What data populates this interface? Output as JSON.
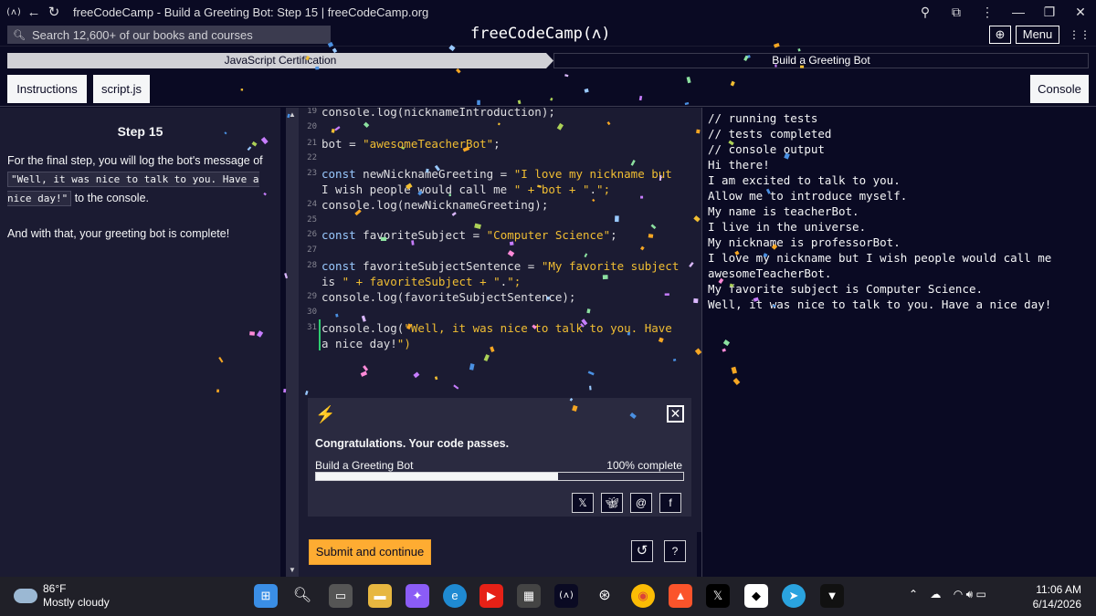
{
  "browser": {
    "title": "freeCodeCamp - Build a Greeting Bot: Step 15 | freeCodeCamp.org",
    "app_icon": "(ʌ)"
  },
  "navbar": {
    "search_placeholder": "Search 12,600+ of our books and courses",
    "logo": "freeCodeCamp(ʌ)",
    "menu_label": "Menu"
  },
  "breadcrumb": {
    "certification": "JavaScript Certification",
    "project": "Build a Greeting Bot"
  },
  "tabs": {
    "instructions": "Instructions",
    "file": "script.js",
    "console": "Console"
  },
  "instructions": {
    "heading": "Step 15",
    "p1_before": "For the final step, you will log the bot's message of ",
    "p1_code": "\"Well, it was nice to talk to you. Have a nice day!\"",
    "p1_after": " to the console.",
    "p2": "And with that, your greeting bot is complete!"
  },
  "editor": {
    "lines": [
      {
        "n": "19",
        "t": "console.log(nicknameIntroduction);"
      },
      {
        "n": "20",
        "t": ""
      },
      {
        "n": "21",
        "t": "bot = \"awesomeTeacherBot\";"
      },
      {
        "n": "22",
        "t": ""
      },
      {
        "n": "23",
        "t": "const newNicknameGreeting = \"I love my nickname but"
      },
      {
        "n": "",
        "t": "I wish people would call me \" + bot + \".\";"
      },
      {
        "n": "24",
        "t": "console.log(newNicknameGreeting);"
      },
      {
        "n": "25",
        "t": ""
      },
      {
        "n": "26",
        "t": "const favoriteSubject = \"Computer Science\";"
      },
      {
        "n": "27",
        "t": ""
      },
      {
        "n": "28",
        "t": "const favoriteSubjectSentence = \"My favorite subject"
      },
      {
        "n": "",
        "t": "is \" + favoriteSubject + \".\";"
      },
      {
        "n": "29",
        "t": "console.log(favoriteSubjectSentence);"
      },
      {
        "n": "30",
        "t": ""
      },
      {
        "n": "31",
        "t": "console.log(\"Well, it was nice to talk to you. Have"
      },
      {
        "n": "",
        "t": "a nice day!\")"
      }
    ]
  },
  "modal": {
    "message": "Congratulations. Your code passes.",
    "project_name": "Build a Greeting Bot",
    "percent_label": "100% complete",
    "progress": 0.66
  },
  "actions": {
    "submit_label": "Submit and continue"
  },
  "console": {
    "lines": [
      "// running tests",
      "// tests completed",
      "// console output",
      "Hi there!",
      "I am excited to talk to you.",
      "Allow me to introduce myself.",
      "My name is teacherBot.",
      "I live in the universe.",
      "My nickname is professorBot.",
      "I love my nickname but I wish people would call me awesomeTeacherBot.",
      "My favorite subject is Computer Science.",
      "Well, it was nice to talk to you. Have a nice day!"
    ]
  },
  "taskbar": {
    "temperature": "86°F",
    "condition": "Mostly cloudy",
    "time": "11:06 AM",
    "date": "6/14/2026"
  },
  "colors": {
    "background": "#0a0a23",
    "panel": "#1b1b32",
    "accent_yellow": "#feac32",
    "keyword": "#99c9ff",
    "string": "#f1be32"
  }
}
